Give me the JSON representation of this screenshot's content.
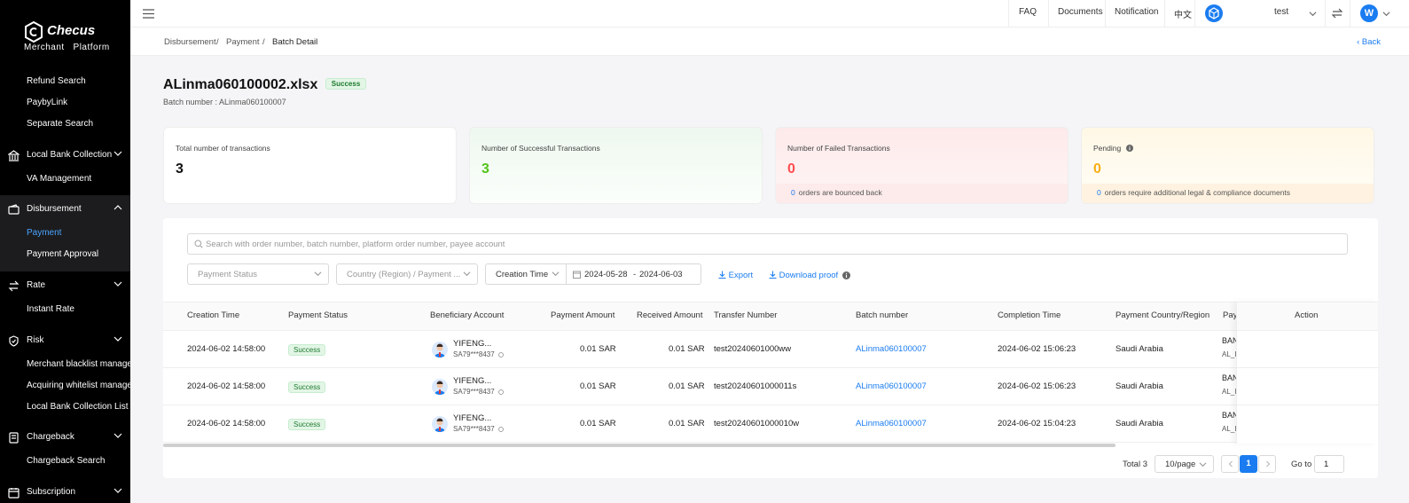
{
  "brand": {
    "name": "Checus",
    "sub": "Merchant   Platform"
  },
  "sidebar": {
    "top_items": [
      "Refund Search",
      "PaybyLink",
      "Separate Search"
    ],
    "groups": [
      {
        "label": "Local Bank Collection",
        "icon": "bank-icon",
        "children": [
          "VA Management"
        ]
      },
      {
        "label": "Disbursement",
        "icon": "wallet-icon",
        "children": [
          "Payment",
          "Payment Approval"
        ],
        "active_child": "Payment"
      },
      {
        "label": "Rate",
        "icon": "exchange-icon",
        "children": [
          "Instant Rate"
        ]
      },
      {
        "label": "Risk",
        "icon": "shield-icon",
        "children": [
          "Merchant blacklist managem",
          "Acquiring whitelist managem",
          "Local Bank Collection List"
        ]
      },
      {
        "label": "Chargeback",
        "icon": "document-icon",
        "children": [
          "Chargeback Search"
        ]
      },
      {
        "label": "Subscription",
        "icon": "calendar-icon",
        "children": []
      }
    ]
  },
  "topbar": {
    "faq": "FAQ",
    "documents": "Documents",
    "notification": "Notification",
    "lang": "中文",
    "user": "test",
    "user_initial": "W"
  },
  "breadcrumb": {
    "items": [
      "Disbursement",
      "Payment",
      "Batch Detail"
    ],
    "sep": "/",
    "back": "‹ Back"
  },
  "batch": {
    "filename": "ALinma060100002.xlsx",
    "status": "Success",
    "batch_number": "Batch number : ALinma060100007"
  },
  "cards": {
    "total": {
      "label": "Total number of transactions",
      "value": "3"
    },
    "success": {
      "label": "Number of Successful Transactions",
      "value": "3"
    },
    "failed": {
      "label": "Number of Failed Transactions",
      "value": "0",
      "foot_count": "0",
      "foot_text": "orders are bounced back"
    },
    "pending": {
      "label": "Pending",
      "value": "0",
      "foot_count": "0",
      "foot_text": "orders require additional legal & compliance documents"
    }
  },
  "colors": {
    "success": "#52c41a",
    "failed": "#ff4d4f",
    "pending": "#faad14",
    "accent": "#1a7cf0"
  },
  "filters": {
    "search_placeholder": "Search with order number, batch number, platform order number, payee account",
    "payment_status": "Payment Status",
    "country": "Country (Region) / Payment ...",
    "time_type": "Creation Time",
    "date_from": "2024-05-28",
    "date_sep": "-",
    "date_to": "2024-06-03",
    "export": "Export",
    "download": "Download proof"
  },
  "table": {
    "headers": [
      "Creation Time",
      "Payment Status",
      "Beneficiary Account",
      "Payment Amount",
      "Received Amount",
      "Transfer Number",
      "Batch number",
      "Completion Time",
      "Payment Country/Region",
      "Pay",
      "Action"
    ],
    "rows": [
      {
        "created": "2024-06-02 14:58:00",
        "status": "Success",
        "ben_name": "YIFENG...",
        "ben_acct": "SA79***8437",
        "pay_amt": "0.01 SAR",
        "recv_amt": "0.01 SAR",
        "transfer": "test20240601000ww",
        "batch": "ALinma060100007",
        "completed": "2024-06-02 15:06:23",
        "country": "Saudi Arabia",
        "pay1": "BAN",
        "pay2": "AL_I"
      },
      {
        "created": "2024-06-02 14:58:00",
        "status": "Success",
        "ben_name": "YIFENG...",
        "ben_acct": "SA79***8437",
        "pay_amt": "0.01 SAR",
        "recv_amt": "0.01 SAR",
        "transfer": "test20240601000011s",
        "batch": "ALinma060100007",
        "completed": "2024-06-02 15:06:23",
        "country": "Saudi Arabia",
        "pay1": "BAN",
        "pay2": "AL_I"
      },
      {
        "created": "2024-06-02 14:58:00",
        "status": "Success",
        "ben_name": "YIFENG...",
        "ben_acct": "SA79***8437",
        "pay_amt": "0.01 SAR",
        "recv_amt": "0.01 SAR",
        "transfer": "test20240601000010w",
        "batch": "ALinma060100007",
        "completed": "2024-06-02 15:04:23",
        "country": "Saudi Arabia",
        "pay1": "BAN",
        "pay2": "AL_I"
      }
    ]
  },
  "pagination": {
    "total": "Total 3",
    "page_size": "10/page",
    "current": "1",
    "goto_label": "Go to",
    "goto_value": "1"
  }
}
